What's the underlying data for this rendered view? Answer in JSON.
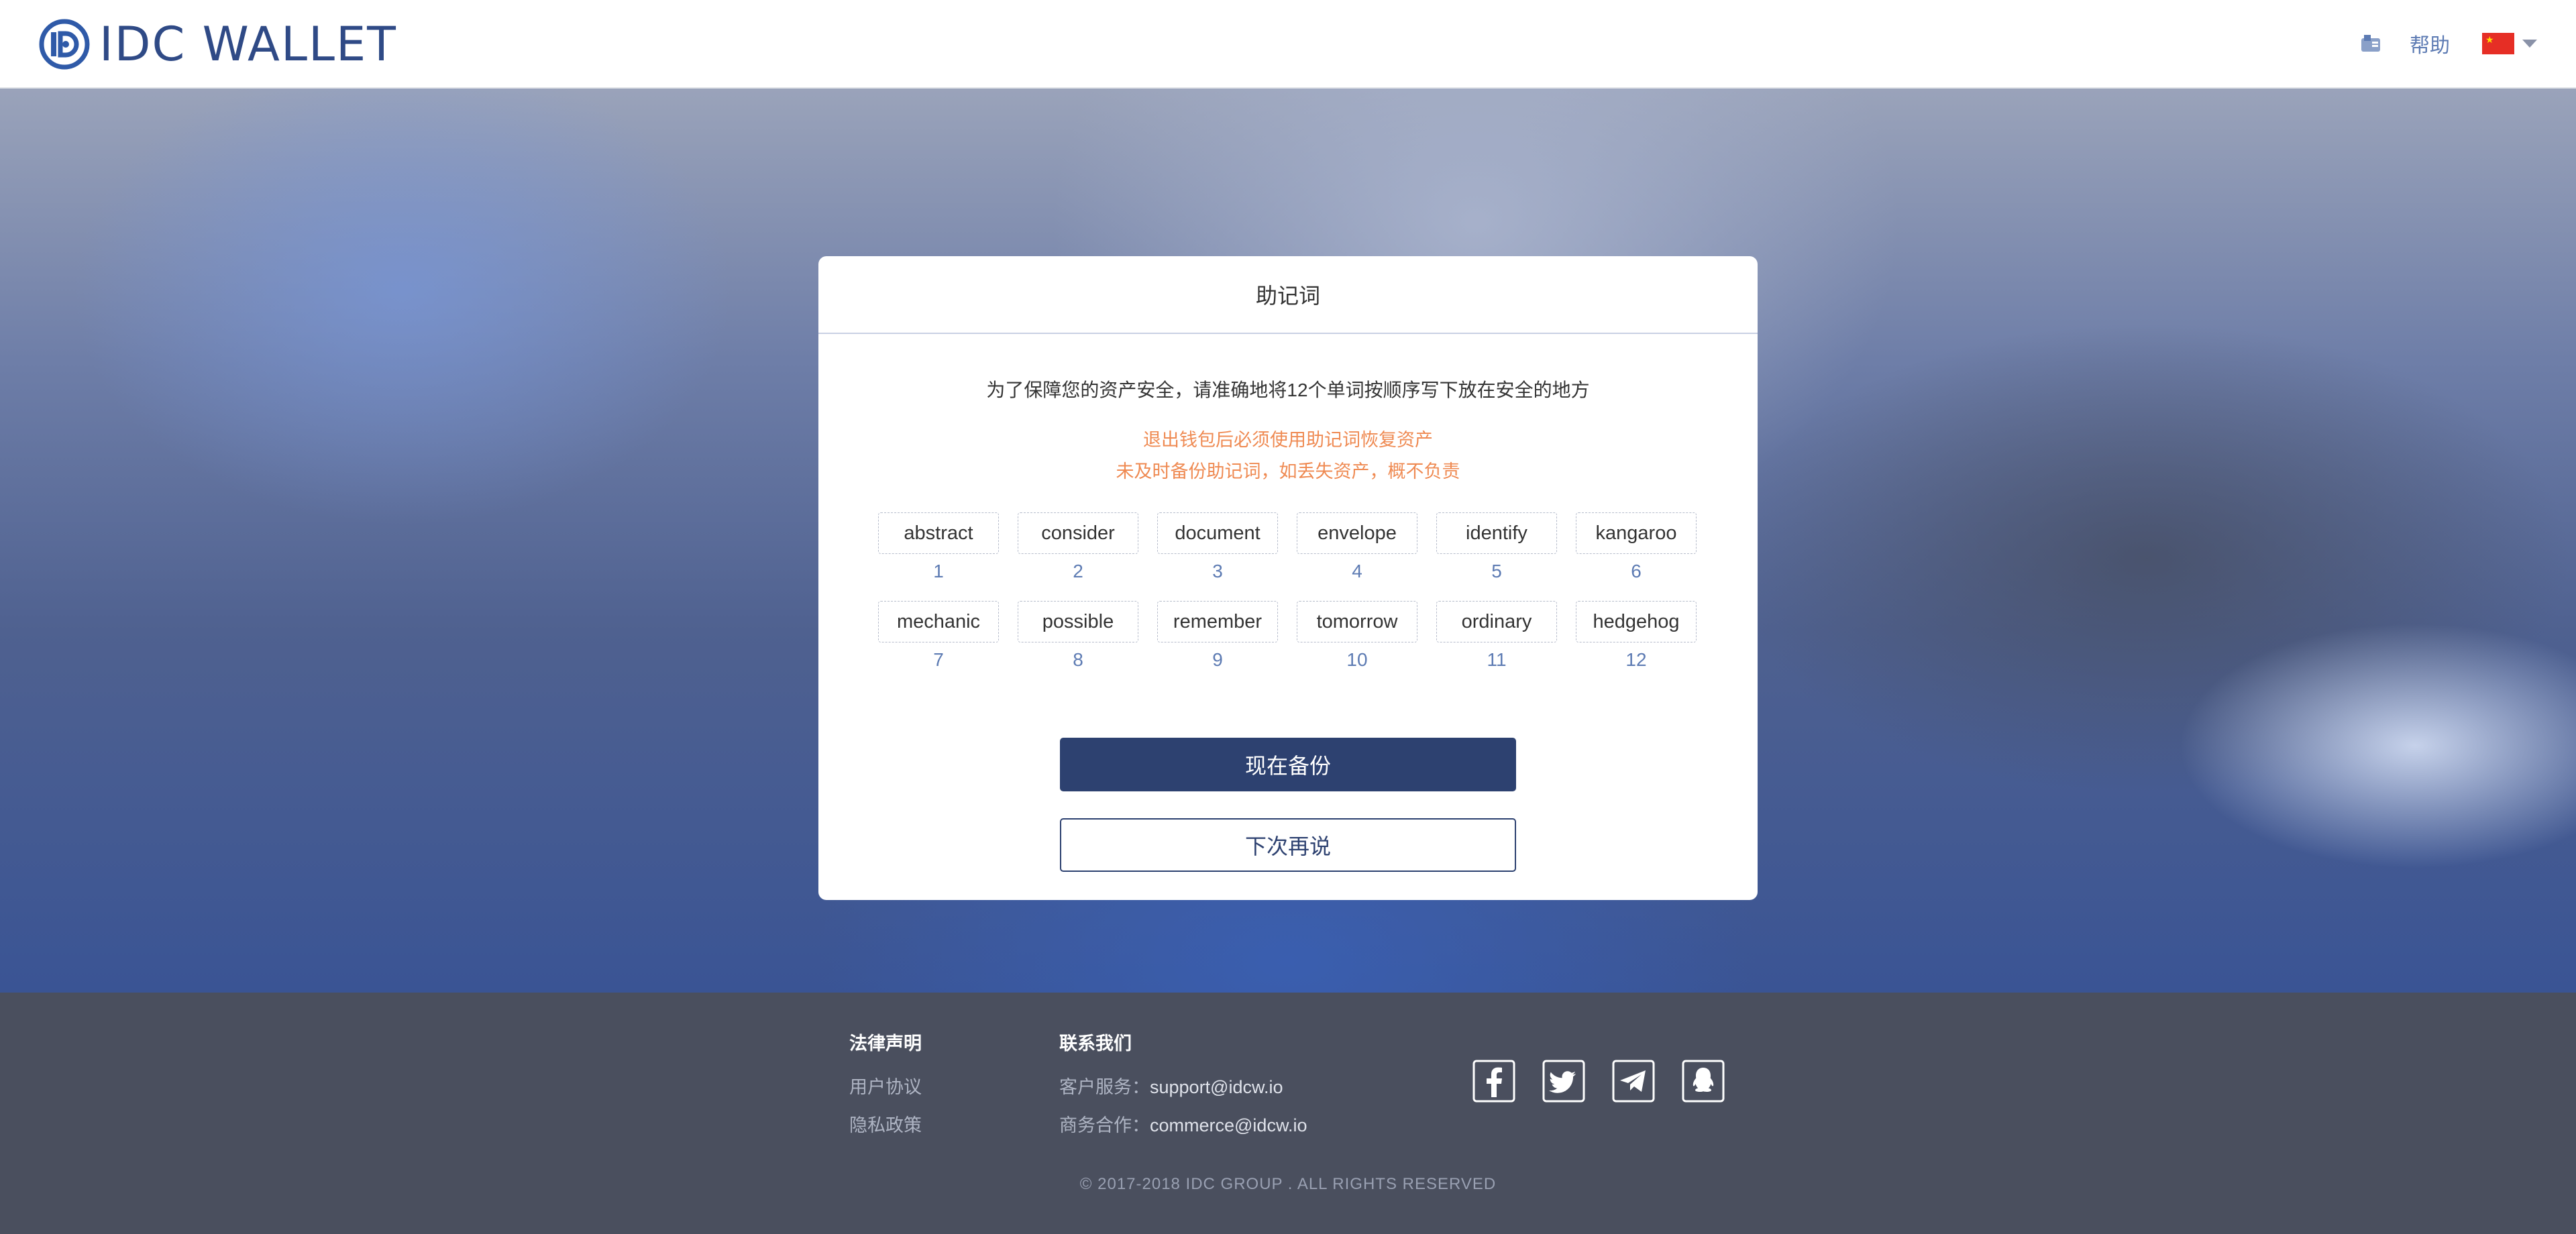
{
  "header": {
    "logo_text": "IDC WALLET",
    "help_label": "帮助",
    "language_flag": "china-flag-icon",
    "mail_icon": "mail-icon"
  },
  "card": {
    "title": "助记词",
    "intro": "为了保障您的资产安全，请准确地将12个单词按顺序写下放在安全的地方",
    "warning_line1": "退出钱包后必须使用助记词恢复资产",
    "warning_line2": "未及时备份助记词，如丢失资产，概不负责",
    "words": [
      {
        "word": "abstract",
        "index": "1"
      },
      {
        "word": "consider",
        "index": "2"
      },
      {
        "word": "document",
        "index": "3"
      },
      {
        "word": "envelope",
        "index": "4"
      },
      {
        "word": "identify",
        "index": "5"
      },
      {
        "word": "kangaroo",
        "index": "6"
      },
      {
        "word": "mechanic",
        "index": "7"
      },
      {
        "word": "possible",
        "index": "8"
      },
      {
        "word": "remember",
        "index": "9"
      },
      {
        "word": "tomorrow",
        "index": "10"
      },
      {
        "word": "ordinary",
        "index": "11"
      },
      {
        "word": "hedgehog",
        "index": "12"
      }
    ],
    "primary_button": "现在备份",
    "secondary_button": "下次再说"
  },
  "footer": {
    "legal_heading": "法律声明",
    "legal_links": [
      "用户协议",
      "隐私政策"
    ],
    "contact_heading": "联系我们",
    "support_label": "客户服务：",
    "support_email": "support@idcw.io",
    "business_label": "商务合作：",
    "business_email": "commerce@idcw.io",
    "social_icons": [
      "facebook-icon",
      "twitter-icon",
      "telegram-icon",
      "qq-icon"
    ],
    "copyright": "© 2017-2018 IDC GROUP . ALL RIGHTS RESERVED"
  },
  "colors": {
    "brand": "#2d4170",
    "accent_blue": "#5d7bb3",
    "warning": "#ef8a52",
    "footer_bg": "#4a4f5e"
  }
}
